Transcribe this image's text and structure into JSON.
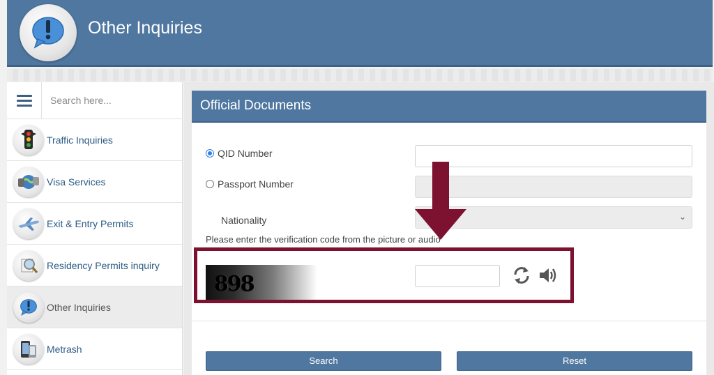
{
  "header": {
    "title": "Other Inquiries",
    "icon": "exclamation-bubble-icon"
  },
  "sidebar": {
    "menu_icon": "hamburger-icon",
    "search_placeholder": "Search here...",
    "items": [
      {
        "label": "Traffic Inquiries",
        "icon": "traffic-light-icon",
        "active": false
      },
      {
        "label": "Visa Services",
        "icon": "globe-icon",
        "active": false
      },
      {
        "label": "Exit & Entry Permits",
        "icon": "airplane-icon",
        "active": false
      },
      {
        "label": "Residency Permits inquiry",
        "icon": "magnifier-icon",
        "active": false
      },
      {
        "label": "Other Inquiries",
        "icon": "exclamation-bubble-icon",
        "active": true
      },
      {
        "label": "Metrash",
        "icon": "phone-icon",
        "active": false
      }
    ]
  },
  "panel": {
    "title": "Official Documents",
    "qid_label": "QID Number",
    "passport_label": "Passport Number",
    "nationality_label": "Nationality",
    "selected_option": "QID Number",
    "verify_text": "Please enter the verification code from the picture or audio",
    "captcha_code": "898",
    "search_label": "Search",
    "reset_label": "Reset"
  },
  "colors": {
    "header": "#4f77a0",
    "highlight": "#7d1130",
    "link": "#2c5b85"
  }
}
